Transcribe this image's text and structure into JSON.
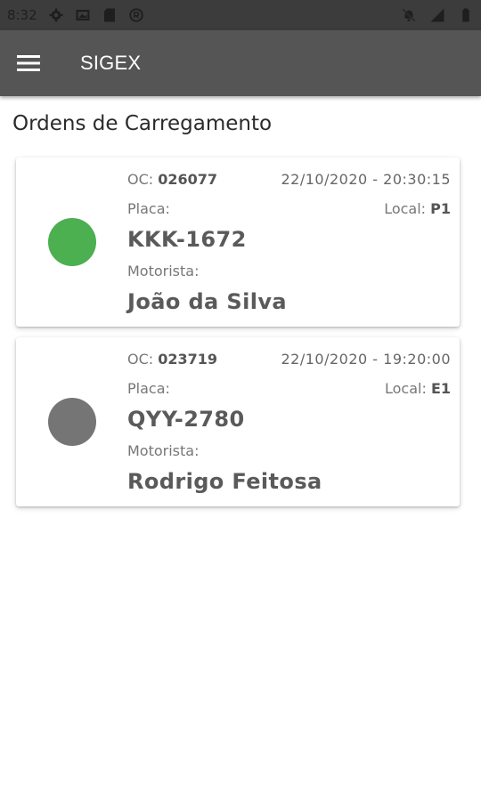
{
  "status_bar": {
    "time": "8:32",
    "left_icons": [
      "gear-icon",
      "image-icon",
      "sd-card-icon",
      "circle-r-icon"
    ],
    "right_icons": [
      "no-notification-icon",
      "signal-icon",
      "battery-icon"
    ]
  },
  "app_bar": {
    "title": "SIGEX",
    "menu_icon": "hamburger-menu-icon",
    "background": "#555555"
  },
  "page": {
    "title": "Ordens de Carregamento"
  },
  "orders": [
    {
      "oc_label": "OC:",
      "oc_number": "026077",
      "datetime": "22/10/2020 - 20:30:15",
      "placa_label": "Placa:",
      "local_label": "Local:",
      "local_value": "P1",
      "plate": "KKK-1672",
      "motorista_label": "Motorista:",
      "driver": "João da Silva",
      "status_color": "#4caf50"
    },
    {
      "oc_label": "OC:",
      "oc_number": "023719",
      "datetime": "22/10/2020 - 19:20:00",
      "placa_label": "Placa:",
      "local_label": "Local:",
      "local_value": "E1",
      "plate": "QYY-2780",
      "motorista_label": "Motorista:",
      "driver": "Rodrigo Feitosa",
      "status_color": "#757575"
    }
  ]
}
